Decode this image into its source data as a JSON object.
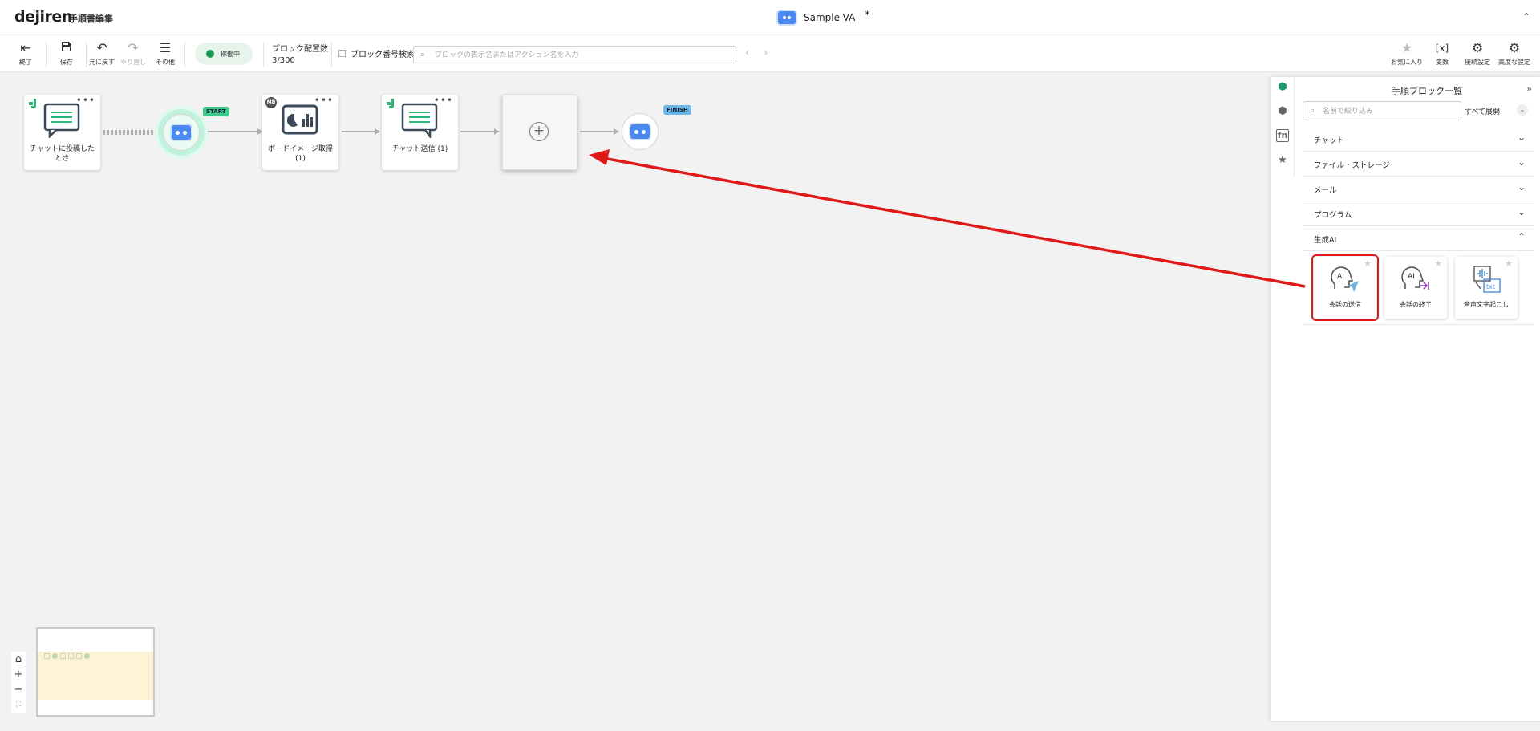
{
  "header": {
    "logo": "dejiren",
    "mode": "手順書編集",
    "app_name": "Sample-VA",
    "unsaved_mark": "*",
    "collapse_icon": "chevron-up-double"
  },
  "toolbar": {
    "exit_label": "終了",
    "save_label": "保存",
    "undo_label": "元に戻す",
    "redo_label": "やり直し",
    "more_label": "その他",
    "status_text": "稼働中",
    "status_color": "#1a9a56",
    "block_count_label": "ブロック配置数",
    "block_count_value": "3/300",
    "block_number_search_label": "ブロック番号検索",
    "search_placeholder": "ブロックの表示名またはアクション名を入力",
    "favorites_label": "お気に入り",
    "variables_label": "変数",
    "connection_label": "接続設定",
    "advanced_label": "高度な設定"
  },
  "canvas": {
    "nodes": [
      {
        "label": "チャットに投稿したとき",
        "icon": "chat-bubble-icon",
        "badge": "dejiren-icon"
      },
      {
        "label": "ボードイメージ取得 (1)",
        "icon": "chart-board-icon",
        "badge": "MB"
      },
      {
        "label": "チャット送信 (1)",
        "icon": "chat-bubble-icon",
        "badge": "dejiren-icon"
      }
    ],
    "start_tag": "START",
    "finish_tag": "FINISH",
    "start_color": "#3cc98a",
    "finish_color": "#6ab7e8"
  },
  "panel": {
    "title": "手順ブロック一覧",
    "filter_placeholder": "名前で絞り込み",
    "expand_all": "すべて展開",
    "categories": [
      {
        "label": "チャット",
        "expanded": false
      },
      {
        "label": "ファイル・ストレージ",
        "expanded": false
      },
      {
        "label": "メール",
        "expanded": false
      },
      {
        "label": "プログラム",
        "expanded": false
      },
      {
        "label": "生成AI",
        "expanded": true
      }
    ],
    "ai_blocks": [
      {
        "name": "会話の送信",
        "icon": "ai-send-icon",
        "selected": true
      },
      {
        "name": "会話の終了",
        "icon": "ai-end-icon",
        "selected": false
      },
      {
        "name": "音声文字起こし",
        "icon": "transcribe-icon",
        "selected": false
      }
    ],
    "highlight_color": "#e01818"
  }
}
